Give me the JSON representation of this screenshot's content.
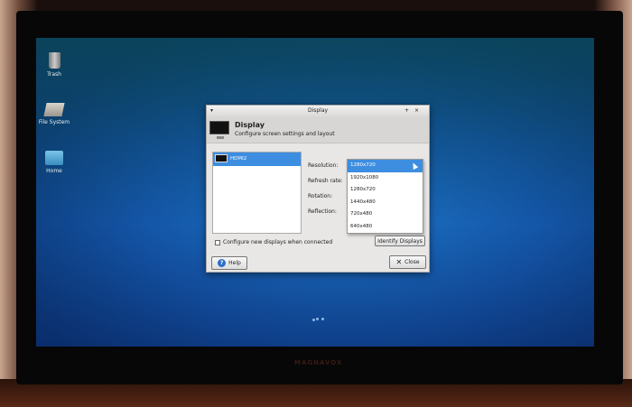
{
  "monitor": {
    "brand": "MAGNAVOX"
  },
  "desktop": {
    "icons": [
      {
        "label": "Trash"
      },
      {
        "label": "File System"
      },
      {
        "label": "Home"
      }
    ]
  },
  "dialog": {
    "window_title": "Display",
    "title_controls": {
      "menu": "▾",
      "maximize": "+",
      "close": "×"
    },
    "header_title": "Display",
    "header_subtitle": "Configure screen settings and layout",
    "displays": [
      {
        "name": "HDMI2",
        "selected": true
      }
    ],
    "labels": {
      "resolution": "Resolution:",
      "refresh": "Refresh rate:",
      "rotation": "Rotation:",
      "reflection": "Reflection:"
    },
    "resolution_selected": "1280x720",
    "resolution_options": [
      "1920x1080",
      "1280x720",
      "1440x480",
      "720x480",
      "640x480"
    ],
    "configure_new_label": "Configure new displays when connected",
    "configure_new_checked": false,
    "identify_label": "Identify Displays",
    "help_label": "Help",
    "close_label": "Close"
  }
}
